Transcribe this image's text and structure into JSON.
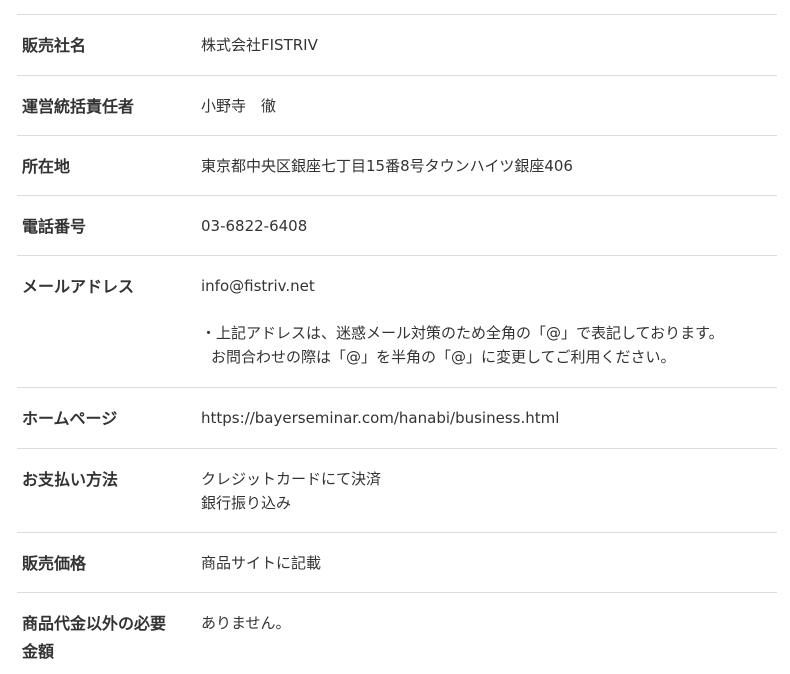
{
  "rows": [
    {
      "label": "販売社名",
      "lines": [
        "株式会社FISTRIV"
      ]
    },
    {
      "label": "運営統括責任者",
      "lines": [
        "小野寺　徹"
      ]
    },
    {
      "label": "所在地",
      "lines": [
        "東京都中央区銀座七丁目15番8号タウンハイツ銀座406"
      ]
    },
    {
      "label": "電話番号",
      "lines": [
        "03-6822-6408"
      ]
    },
    {
      "label": "メールアドレス",
      "lines": [
        "info@fistriv.net"
      ],
      "note": [
        "・上記アドレスは、迷惑メール対策のため全角の「@」で表記しております。",
        "お問合わせの際は「@」を半角の「@」に変更してご利用ください。"
      ]
    },
    {
      "label": "ホームページ",
      "lines": [
        "https://bayerseminar.com/hanabi/business.html"
      ]
    },
    {
      "label": "お支払い方法",
      "lines": [
        "クレジットカードにて決済",
        "銀行振り込み"
      ]
    },
    {
      "label": "販売価格",
      "lines": [
        "商品サイトに記載"
      ]
    },
    {
      "label": "商品代金以外の必要金額",
      "lines": [
        "ありません。"
      ]
    }
  ]
}
